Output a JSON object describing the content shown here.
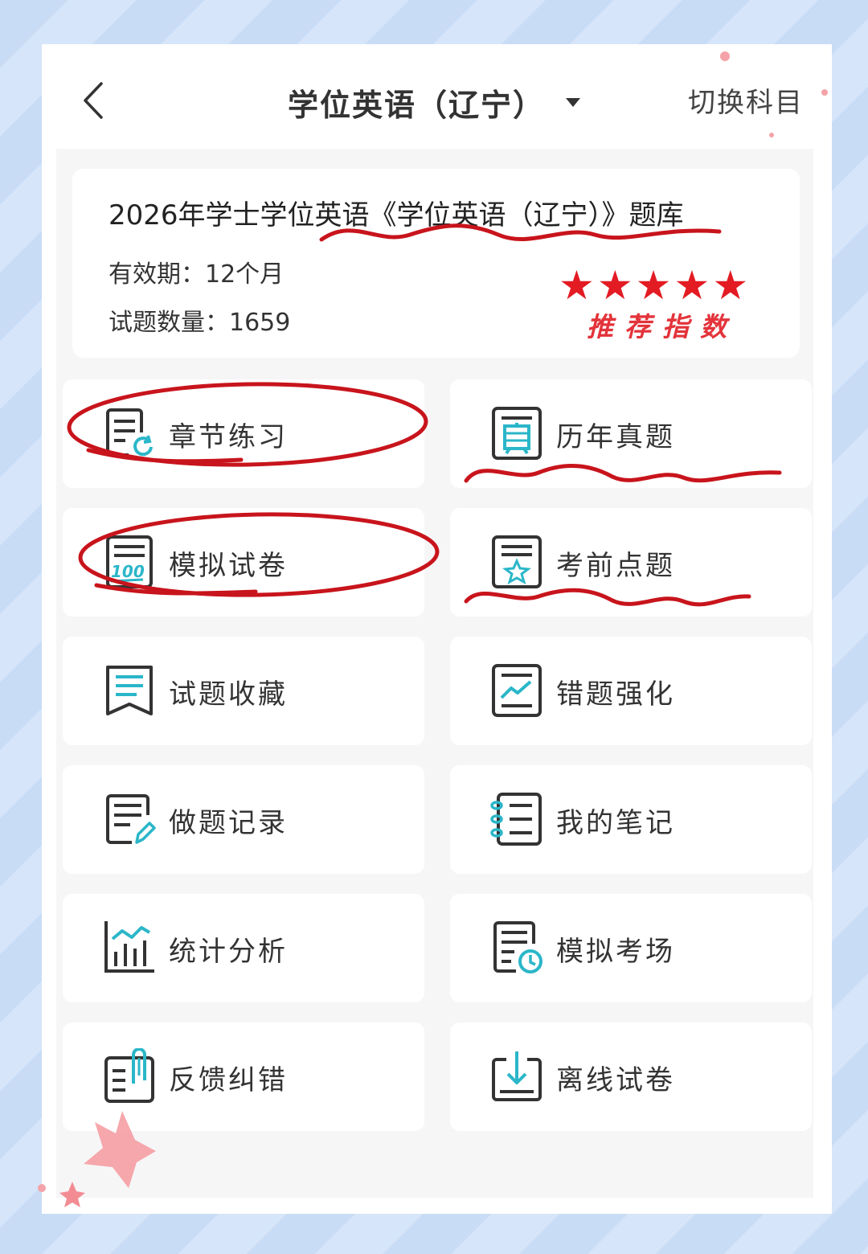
{
  "header": {
    "title": "学位英语（辽宁）",
    "switch_label": "切换科目"
  },
  "info_card": {
    "title": "2026年学士学位英语《学位英语（辽宁）》题库",
    "validity_label": "有效期：",
    "validity_value": "12个月",
    "count_label": "试题数量：",
    "count_value": "1659",
    "rating": 5,
    "rating_label": "推荐指数"
  },
  "menu": [
    {
      "label": "章节练习",
      "icon": "chapter-practice-icon"
    },
    {
      "label": "历年真题",
      "icon": "past-exams-icon"
    },
    {
      "label": "模拟试卷",
      "icon": "mock-paper-icon"
    },
    {
      "label": "考前点题",
      "icon": "key-points-icon"
    },
    {
      "label": "试题收藏",
      "icon": "favorites-icon"
    },
    {
      "label": "错题强化",
      "icon": "mistakes-icon"
    },
    {
      "label": "做题记录",
      "icon": "history-icon"
    },
    {
      "label": "我的笔记",
      "icon": "notes-icon"
    },
    {
      "label": "统计分析",
      "icon": "statistics-icon"
    },
    {
      "label": "模拟考场",
      "icon": "mock-exam-room-icon"
    },
    {
      "label": "反馈纠错",
      "icon": "feedback-icon"
    },
    {
      "label": "离线试卷",
      "icon": "offline-download-icon"
    }
  ],
  "colors": {
    "accent": "#2bb6c9",
    "annotation_red": "#c8141c",
    "star_red": "#e31b23",
    "background_blue": "#c9dcf6"
  }
}
